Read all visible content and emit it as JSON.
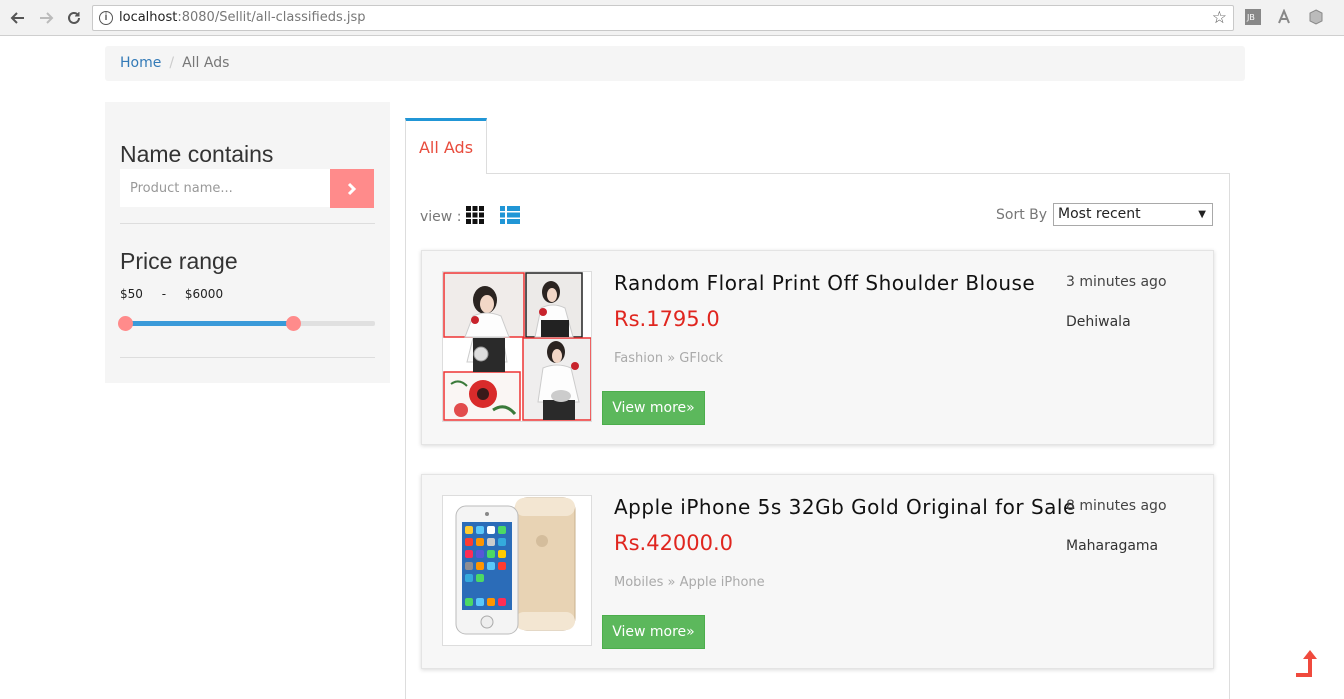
{
  "browser": {
    "url_host": "localhost",
    "url_rest": ":8080/Sellit/all-classifieds.jsp"
  },
  "breadcrumb": {
    "home": "Home",
    "separator": "/",
    "current": "All Ads"
  },
  "sidebar": {
    "name_title": "Name contains",
    "name_placeholder": "Product name...",
    "price_title": "Price range",
    "price_min": "$50",
    "price_dash": "-",
    "price_max": "$6000",
    "slider_low_fraction": 0.0,
    "slider_high_fraction": 0.67
  },
  "tabs": {
    "active": "All Ads"
  },
  "toolbar": {
    "view_label": "view :",
    "sort_label": "Sort By :",
    "sort_value": "Most recent"
  },
  "ads": [
    {
      "title": "Random Floral Print Off Shoulder Blouse",
      "price": "Rs.1795.0",
      "category": "Fashion » GFlock",
      "time": "3 minutes ago",
      "location": "Dehiwala",
      "button": "View more»"
    },
    {
      "title": "Apple iPhone 5s 32Gb Gold Original for Sale",
      "price": "Rs.42000.0",
      "category": "Mobiles » Apple iPhone",
      "time": "8 minutes ago",
      "location": "Maharagama",
      "button": "View more»"
    }
  ],
  "colors": {
    "accent_blue": "#2196d6",
    "tab_text": "#e84c3d",
    "price_red": "#e0261f",
    "button_green": "#5cb85c",
    "salmon": "#ff8b8b"
  }
}
